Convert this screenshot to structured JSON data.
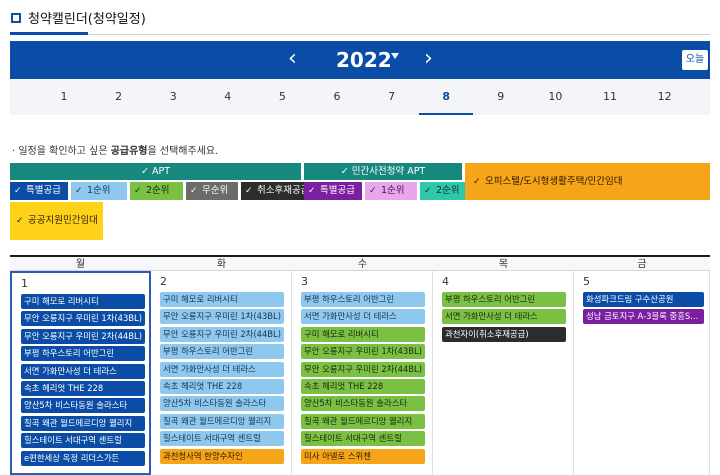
{
  "page_title": "청약캘린더(청약일정)",
  "year": {
    "label": "2022",
    "prev_icon": "‹",
    "next_icon": "›",
    "today_label": "오늘"
  },
  "months": [
    "1",
    "2",
    "3",
    "4",
    "5",
    "6",
    "7",
    "8",
    "9",
    "10",
    "11",
    "12"
  ],
  "selected_month": "8",
  "instruction": {
    "prefix": "· 일정을 확인하고 싶은 ",
    "emphasis": "공급유형",
    "suffix": "을 선택해주세요."
  },
  "filters": {
    "apt": {
      "label": "✓ APT",
      "color": "#16887e",
      "items": [
        {
          "label": "특별공급",
          "bg": "#0a4ca6",
          "fg": "#ffffff"
        },
        {
          "label": "1순위",
          "bg": "#8ec8ee",
          "fg": "#1a3550"
        },
        {
          "label": "2순위",
          "bg": "#79c043",
          "fg": "#1b2a10"
        },
        {
          "label": "무순위",
          "bg": "#6b6b6b",
          "fg": "#ffffff"
        },
        {
          "label": "취소후재공급",
          "bg": "#2c2c2c",
          "fg": "#ffffff"
        }
      ]
    },
    "private_pre": {
      "label": "✓ 민간사전청약 APT",
      "color": "#16887e",
      "items": [
        {
          "label": "특별공급",
          "bg": "#7a1fa2",
          "fg": "#ffffff"
        },
        {
          "label": "1순위",
          "bg": "#e7a6ee",
          "fg": "#3a1a40"
        },
        {
          "label": "2순위",
          "bg": "#2ec7a7",
          "fg": "#0d2e27"
        }
      ]
    },
    "officetel": {
      "label": "오피스텔/도시형생활주택/민간임대",
      "color": "#f6a418"
    },
    "public_rental": {
      "label": "공공지원민간임대",
      "color": "#ffd21a"
    },
    "check_icon": "✓"
  },
  "calendar": {
    "weekdays": [
      "월",
      "화",
      "수",
      "목",
      "금"
    ],
    "days": [
      {
        "num": "1",
        "events": [
          {
            "title": "구미 해모로 리버시티",
            "type": "special"
          },
          {
            "title": "무안 오룡지구 우미린 1차(43BL)",
            "type": "special"
          },
          {
            "title": "무안 오룡지구 우미린 2차(44BL)",
            "type": "special"
          },
          {
            "title": "부평 하우스토리 어반그린",
            "type": "special"
          },
          {
            "title": "서면 가화만사성 더 테라스",
            "type": "special"
          },
          {
            "title": "속초 헤리엇 THE 228",
            "type": "special"
          },
          {
            "title": "양산5차 비스타동원 솔라스타",
            "type": "special"
          },
          {
            "title": "칠곡 왜관 월드메르디앙 웰리지",
            "type": "special"
          },
          {
            "title": "힐스테이트 서대구역 센트럴",
            "type": "special"
          },
          {
            "title": "e편한세상 옥정 리더스가든",
            "type": "special"
          }
        ]
      },
      {
        "num": "2",
        "events": [
          {
            "title": "구미 해모로 리버시티",
            "type": "first"
          },
          {
            "title": "무안 오룡지구 우미린 1차(43BL)",
            "type": "first"
          },
          {
            "title": "무안 오룡지구 우미린 2차(44BL)",
            "type": "first"
          },
          {
            "title": "부평 하우스토리 어반그린",
            "type": "first"
          },
          {
            "title": "서면 가화만사성 더 테라스",
            "type": "first"
          },
          {
            "title": "속초 헤리엇 THE 228",
            "type": "first"
          },
          {
            "title": "양산5차 비스타동원 솔라스타",
            "type": "first"
          },
          {
            "title": "칠곡 왜관 월드메르디앙 웰리지",
            "type": "first"
          },
          {
            "title": "힐스테이트 서대구역 센트럴",
            "type": "first"
          },
          {
            "title": "과천청사역 한양수자인",
            "type": "officetel"
          }
        ]
      },
      {
        "num": "3",
        "events": [
          {
            "title": "부평 하우스토리 어반그린",
            "type": "first"
          },
          {
            "title": "서면 가화만사성 더 테라스",
            "type": "first"
          },
          {
            "title": "구미 해모로 리버시티",
            "type": "second"
          },
          {
            "title": "무안 오룡지구 우미린 1차(43BL)",
            "type": "second"
          },
          {
            "title": "무안 오룡지구 우미린 2차(44BL)",
            "type": "second"
          },
          {
            "title": "속초 헤리엇 THE 228",
            "type": "second"
          },
          {
            "title": "양산5차 비스타동원 솔라스타",
            "type": "second"
          },
          {
            "title": "칠곡 왜관 월드메르디앙 웰리지",
            "type": "second"
          },
          {
            "title": "힐스테이트 서대구역 센트럴",
            "type": "second"
          },
          {
            "title": "미사 아넬로 스위첸",
            "type": "officetel"
          }
        ]
      },
      {
        "num": "4",
        "events": [
          {
            "title": "부평 하우스토리 어반그린",
            "type": "second"
          },
          {
            "title": "서면 가화만사성 더 테라스",
            "type": "second"
          },
          {
            "title": "과천자이(취소후재공급)",
            "type": "cancel"
          }
        ]
      },
      {
        "num": "5",
        "events": [
          {
            "title": "화성파크드림 구수산공원",
            "type": "special"
          },
          {
            "title": "성남 금토지구 A-3블록 중흥S...",
            "type": "pre_special"
          }
        ]
      }
    ]
  },
  "colors": {
    "special": {
      "bg": "#0a4ca6",
      "fg": "#ffffff"
    },
    "first": {
      "bg": "#8ec8ee",
      "fg": "#1a3550"
    },
    "second": {
      "bg": "#79c043",
      "fg": "#1b2a10"
    },
    "cancel": {
      "bg": "#2c2c2c",
      "fg": "#ffffff"
    },
    "officetel": {
      "bg": "#f6a418",
      "fg": "#2a1a00"
    },
    "pre_special": {
      "bg": "#7a1fa2",
      "fg": "#ffffff"
    }
  }
}
